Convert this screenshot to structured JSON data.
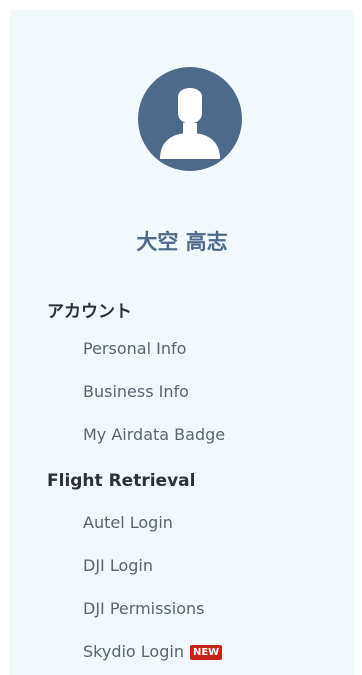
{
  "profile": {
    "avatar_icon": "user-silhouette-icon",
    "name": "大空 高志"
  },
  "sections": {
    "account": {
      "heading": "アカウント",
      "items": [
        "Personal Info",
        "Business Info",
        "My Airdata Badge"
      ]
    },
    "flight_retrieval": {
      "heading": "Flight Retrieval",
      "items": [
        "Autel Login",
        "DJI Login",
        "DJI Permissions",
        "Skydio Login"
      ]
    }
  },
  "badges": {
    "skydio_login": "NEW"
  },
  "colors": {
    "panel_bg": "#f1f9fc",
    "avatar_bg": "#4e6a8b",
    "name_color": "#4e6a8b",
    "heading_color": "#2d3135",
    "link_color": "#5a6570",
    "badge_bg": "#c62318"
  }
}
